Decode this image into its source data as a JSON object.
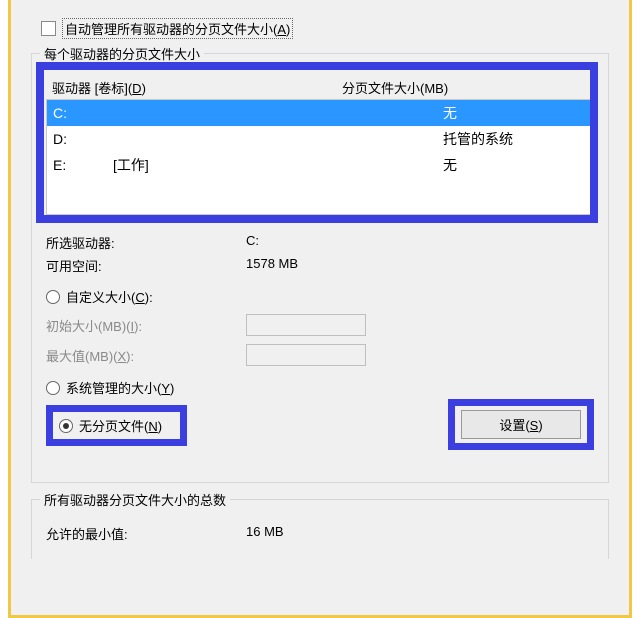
{
  "checkbox": {
    "auto_manage_label": "自动管理所有驱动器的分页文件大小(",
    "auto_manage_hotkey": "A",
    "auto_manage_close": ")"
  },
  "group": {
    "per_drive_caption": "每个驱动器的分页文件大小",
    "drive_col_label": "驱动器 [卷标](",
    "drive_col_hotkey": "D",
    "drive_col_close": ")",
    "size_col_label": "分页文件大小(MB)",
    "drives": [
      {
        "letter": "C:",
        "volume": "",
        "size": "无",
        "selected": true
      },
      {
        "letter": "D:",
        "volume": "",
        "size": "托管的系统",
        "selected": false
      },
      {
        "letter": "E:",
        "volume": "[工作]",
        "size": "无",
        "selected": false
      }
    ],
    "selected_drive_label": "所选驱动器:",
    "selected_drive_value": "C:",
    "free_space_label": "可用空间:",
    "free_space_value": "1578 MB",
    "custom_size_label": "自定义大小(",
    "custom_size_hotkey": "C",
    "custom_size_close": "):",
    "initial_size_label": "初始大小(MB)(",
    "initial_size_hotkey": "I",
    "initial_size_close": "):",
    "max_size_label": "最大值(MB)(",
    "max_size_hotkey": "X",
    "max_size_close": "):",
    "system_managed_label": "系统管理的大小(",
    "system_managed_hotkey": "Y",
    "system_managed_close": ")",
    "no_paging_label": "无分页文件(",
    "no_paging_hotkey": "N",
    "no_paging_close": ")",
    "set_button_label": "设置(",
    "set_button_hotkey": "S",
    "set_button_close": ")"
  },
  "totals": {
    "caption": "所有驱动器分页文件大小的总数",
    "min_allowed_label": "允许的最小值:",
    "min_allowed_value": "16 MB"
  }
}
